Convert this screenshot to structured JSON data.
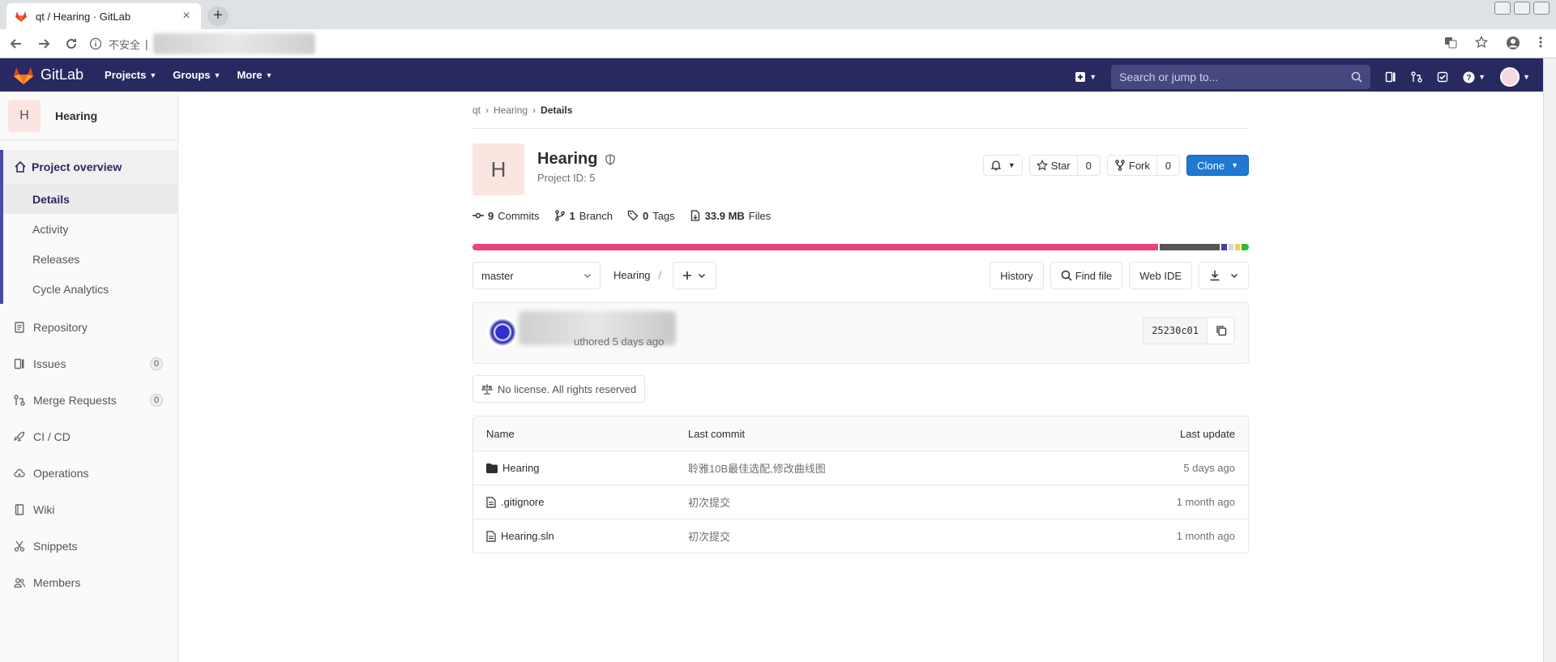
{
  "browser": {
    "tab_title": "qt / Hearing · GitLab",
    "tab_close": "×",
    "new_tab": "+",
    "insecure_label": "不安全",
    "separator": "|"
  },
  "gitlab_header": {
    "logo_text": "GitLab",
    "nav": [
      "Projects",
      "Groups",
      "More"
    ],
    "search_placeholder": "Search or jump to..."
  },
  "sidebar": {
    "project_initial": "H",
    "project_name": "Hearing",
    "overview_label": "Project overview",
    "overview_items": [
      "Details",
      "Activity",
      "Releases",
      "Cycle Analytics"
    ],
    "items": [
      {
        "label": "Repository",
        "icon": "repository-icon"
      },
      {
        "label": "Issues",
        "icon": "issues-icon",
        "badge": "0"
      },
      {
        "label": "Merge Requests",
        "icon": "merge-request-icon",
        "badge": "0"
      },
      {
        "label": "CI / CD",
        "icon": "rocket-icon"
      },
      {
        "label": "Operations",
        "icon": "cloud-gear-icon"
      },
      {
        "label": "Wiki",
        "icon": "book-icon"
      },
      {
        "label": "Snippets",
        "icon": "scissors-icon"
      },
      {
        "label": "Members",
        "icon": "users-icon"
      }
    ]
  },
  "breadcrumb": [
    "qt",
    "Hearing",
    "Details"
  ],
  "project": {
    "initial": "H",
    "name": "Hearing",
    "id_label": "Project ID: 5",
    "star_label": "Star",
    "star_count": "0",
    "fork_label": "Fork",
    "fork_count": "0",
    "clone_label": "Clone"
  },
  "stats": {
    "commits_count": "9",
    "commits_label": "Commits",
    "branch_count": "1",
    "branch_label": "Branch",
    "tags_count": "0",
    "tags_label": "Tags",
    "files_size": "33.9 MB",
    "files_label": "Files"
  },
  "languages": [
    {
      "share": 0.892,
      "color": "#e8447c"
    },
    {
      "share": 0.078,
      "color": "#555555"
    },
    {
      "share": 0.008,
      "color": "#4b3f9e"
    },
    {
      "share": 0.006,
      "color": "#d8d8d8"
    },
    {
      "share": 0.006,
      "color": "#e8d44d"
    },
    {
      "share": 0.01,
      "color": "#2bbf2b"
    }
  ],
  "controls": {
    "branch": "master",
    "path": "Hearing",
    "path_sep": "/",
    "history": "History",
    "find_file": "Find file",
    "web_ide": "Web IDE"
  },
  "commit": {
    "meta": "uthored 5 days ago",
    "sha": "25230c01"
  },
  "license": "No license. All rights reserved",
  "tree": {
    "headers": {
      "name": "Name",
      "last_commit": "Last commit",
      "last_update": "Last update"
    },
    "rows": [
      {
        "name": "Hearing",
        "type": "folder",
        "commit": "聆雅10B最佳选配,修改曲线图",
        "update": "5 days ago"
      },
      {
        "name": ".gitignore",
        "type": "file",
        "commit": "初次提交",
        "update": "1 month ago"
      },
      {
        "name": "Hearing.sln",
        "type": "file",
        "commit": "初次提交",
        "update": "1 month ago"
      }
    ]
  },
  "colors": {
    "header_bg": "#292961",
    "accent": "#1f78d1",
    "sidebar_active": "#4b4ba3"
  }
}
